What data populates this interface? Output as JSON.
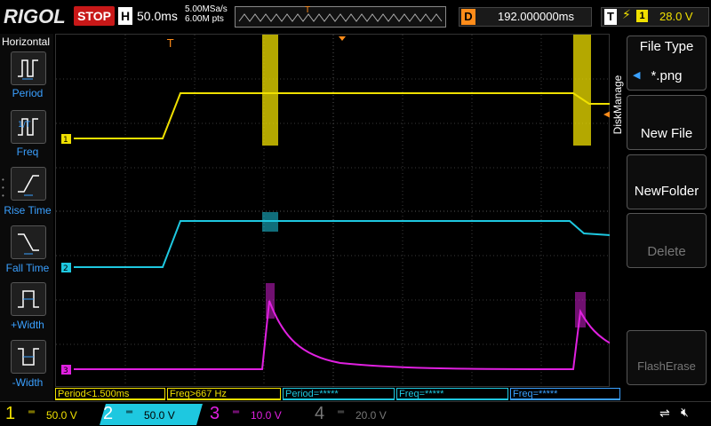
{
  "top": {
    "brand": "RIGOL",
    "run_state": "STOP",
    "horizontal_badge": "H",
    "time_scale": "50.0ms",
    "sample_rate": "5.00MSa/s",
    "memory_depth": "6.00M pts",
    "delay_badge": "D",
    "delay_value": "192.000000ms",
    "trigger_badge": "T",
    "trigger_source": "1",
    "trigger_level": "28.0 V"
  },
  "left_panel": {
    "title": "Horizontal",
    "items": [
      {
        "label": "Period",
        "icon": "period-icon"
      },
      {
        "label": "Freq",
        "icon": "freq-icon"
      },
      {
        "label": "Rise Time",
        "icon": "rise-time-icon"
      },
      {
        "label": "Fall Time",
        "icon": "fall-time-icon"
      },
      {
        "label": "+Width",
        "icon": "pos-width-icon"
      },
      {
        "label": "-Width",
        "icon": "neg-width-icon"
      }
    ]
  },
  "right_panel": {
    "title": "DiskManage",
    "file_type_label": "File Type",
    "file_type_value": "*.png",
    "new_file": "New File",
    "new_folder": "NewFolder",
    "delete": "Delete",
    "flash_erase": "FlashErase"
  },
  "measurements": [
    {
      "text": "Period<1.500ms",
      "color": "#f0e000"
    },
    {
      "text": "Freq>667 Hz",
      "color": "#f0e000"
    },
    {
      "text": "Period=*****",
      "color": "#1ec8e0"
    },
    {
      "text": "Freq=*****",
      "color": "#1ec8e0"
    },
    {
      "text": "Freq=*****",
      "color": "#3aa0ff"
    }
  ],
  "channels": [
    {
      "num": "1",
      "scale": "50.0 V",
      "color": "#f0e000"
    },
    {
      "num": "2",
      "scale": "50.0 V",
      "color": "#1ec8e0"
    },
    {
      "num": "3",
      "scale": "10.0 V",
      "color": "#e020e0"
    },
    {
      "num": "4",
      "scale": "20.0 V",
      "color": "#777777"
    }
  ],
  "trace_markers": [
    "1",
    "2",
    "3"
  ],
  "colors": {
    "ch1": "#f0e000",
    "ch2": "#1ec8e0",
    "ch3": "#e020e0",
    "trigger": "#ff8c1a",
    "stop": "#c81818",
    "accent": "#3aa0ff"
  }
}
